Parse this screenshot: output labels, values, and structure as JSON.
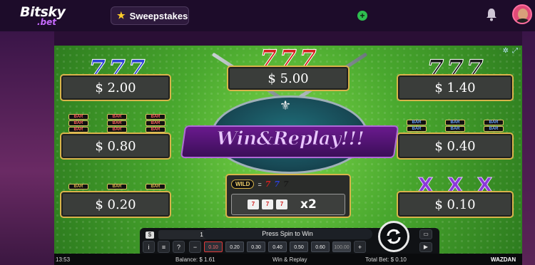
{
  "site": {
    "logo_text": "Bitsky",
    "logo_sub": ".bet",
    "sweepstakes_label": "Sweepstakes"
  },
  "icons": {
    "star": "star-icon",
    "add": "plus-icon",
    "bell": "bell-icon",
    "avatar": "user-avatar",
    "spin": "spin-arrows-icon"
  },
  "paytable": {
    "top_left": "$ 2.00",
    "top_center": "$ 5.00",
    "top_right": "$ 1.40",
    "mid_left": "$ 0.80",
    "mid_right": "$ 0.40",
    "bottom_left": "$ 0.20",
    "bottom_right": "$ 0.10",
    "bar_label": "BAR",
    "seven_symbol": "7",
    "x_symbol": "X"
  },
  "center": {
    "title": "Win&Replay!!!",
    "wild_label": "WILD",
    "equals": "=",
    "multiplier": "x2"
  },
  "controls": {
    "coin_value": "1.61",
    "message": "Press Spin to Win",
    "info_label": "i",
    "menu_label": "≡",
    "help_label": "?",
    "minus_label": "−",
    "plus_label": "+",
    "bets": [
      "0.10",
      "0.20",
      "0.30",
      "0.40",
      "0.50",
      "0.60",
      "100.00"
    ]
  },
  "status": {
    "time": "13:53",
    "balance": "Balance: $ 1.61",
    "game_name": "Win & Replay",
    "total_bet": "Total Bet: $ 0.10",
    "provider": "WAZDAN"
  },
  "colors": {
    "felt_green": "#49a82e",
    "panel_gold": "#d9b44a",
    "seven_blue": "#2b3fd6",
    "seven_red": "#d61f1f",
    "seven_black": "#1a1a1a",
    "x_purple": "#8b3ad8",
    "banner_purple": "#6a1a8e"
  }
}
